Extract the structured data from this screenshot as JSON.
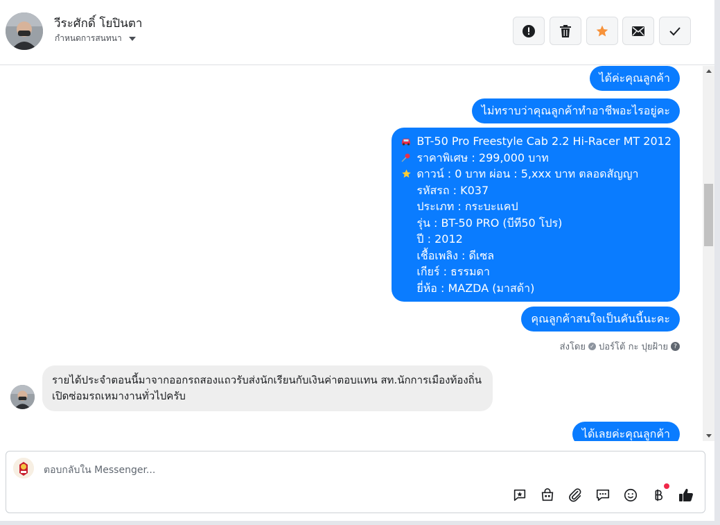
{
  "header": {
    "name": "วีระศักดิ์ โยปินตา",
    "assign_label": "กำหนดการสนทนา",
    "buttons": [
      "mark-spam",
      "delete",
      "star",
      "mark-unread",
      "mark-done"
    ]
  },
  "messages": {
    "out_1": "ได้ค่ะคุณลูกค้า",
    "out_2": "ไม่ทราบว่าคุณลูกค้าทำอาชีพอะไรอยู่คะ",
    "car_card": {
      "line_title": "BT-50 Pro Freestyle Cab 2.2 Hi-Racer MT 2012",
      "line_price": "ราคาพิเศษ : 299,000 บาท",
      "line_down": "ดาวน์ : 0 บาท ผ่อน : 5,xxx บาท ตลอดสัญญา",
      "line_code": "รหัสรถ : K037",
      "line_type": "ประเภท : กระบะแคป",
      "line_model": "รุ่น : BT-50 PRO (บีที50 โปร)",
      "line_year": "ปี : 2012",
      "line_fuel": "เชื้อเพลิง : ดีเซล",
      "line_gear": "เกียร์ : ธรรมดา",
      "line_brand": "ยี่ห้อ : MAZDA (มาสด้า)"
    },
    "out_3": "คุณลูกค้าสนใจเป็นคันนี้นะคะ",
    "sent_by_prefix": "ส่งโดย",
    "sent_by_name": "ปอร์โต้ กะ ปุยฝ้าย",
    "in_1": "รายได้ประจำตอนนี้มาจากออกรถสองแถวรับส่งนักเรียนกับเงินค่าตอบแทน สท.นักการเมืองท้องถิ่น เปิดซ่อมรถเหมางานทั่วไปครับ",
    "out_4": "ได้เลยค่ะคุณลูกค้า"
  },
  "composer": {
    "placeholder": "ตอบกลับใน Messenger...",
    "icons": [
      "saved-reply-icon",
      "shop-icon",
      "attach-icon",
      "quick-reply-icon",
      "emoji-icon",
      "baht-payment-icon",
      "like-icon"
    ]
  },
  "colors": {
    "outgoing_bubble": "#0a7cff",
    "incoming_bubble": "#eeeeee",
    "star": "#f7923a",
    "notification_dot": "#f02849"
  }
}
